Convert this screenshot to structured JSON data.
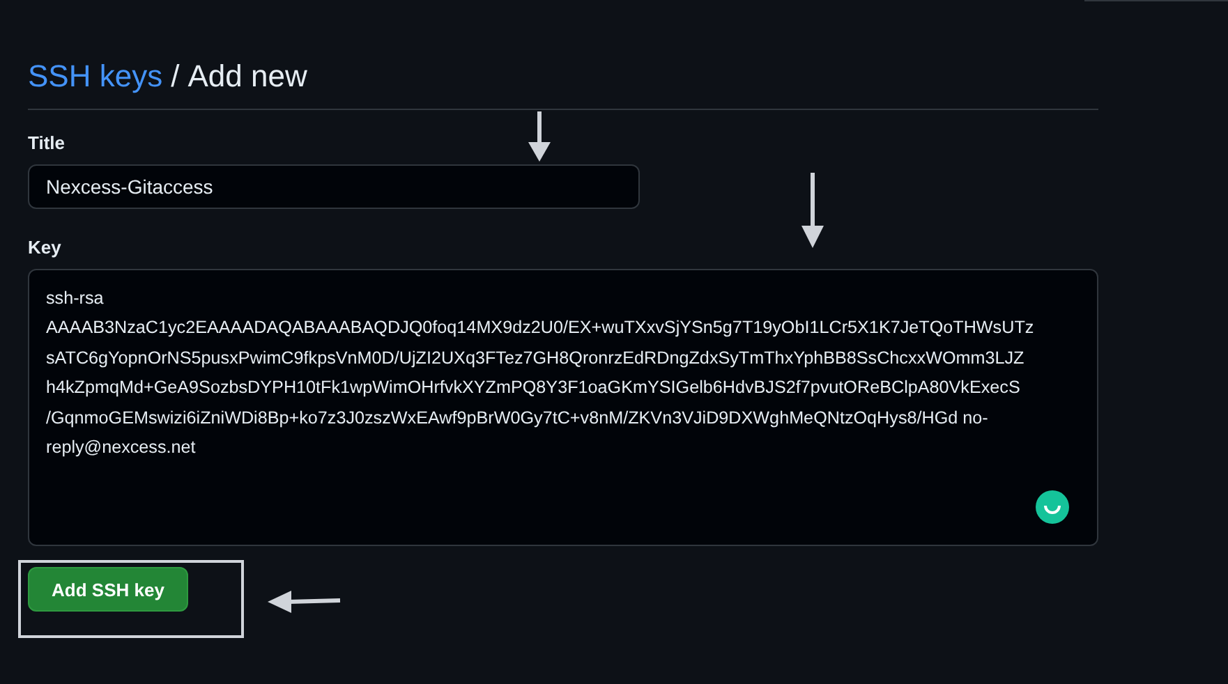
{
  "heading": {
    "link": "SSH keys",
    "separator": "/",
    "title": "Add new"
  },
  "title_field": {
    "label": "Title",
    "value": "Nexcess-Gitaccess"
  },
  "key_field": {
    "label": "Key",
    "value": "ssh-rsa\nAAAAB3NzaC1yc2EAAAADAQABAAABAQDJQ0foq14MX9dz2U0/EX+wuTXxvSjYSn5g7T19yObI1LCr5X1K7JeTQoTHWsUTz\nsATC6gYopnOrNS5pusxPwimC9fkpsVnM0D/UjZI2UXq3FTez7GH8QronrzEdRDngZdxSyTmThxYphBB8SsChcxxWOmm3LJZ\nh4kZpmqMd+GeA9SozbsDYPH10tFk1wpWimOHrfvkXYZmPQ8Y3F1oaGKmYSIGelb6HdvBJS2f7pvutOReBClpA80VkExecS\n/GqnmoGEMswizi6iZniWDi8Bp+ko7z3J0zszWxEAwf9pBrW0Gy7tC+v8nM/ZKVn3VJiD9DXWghMeQNtzOqHys8/HGd no-\nreply@nexcess.net"
  },
  "submit": {
    "label": "Add SSH key"
  }
}
